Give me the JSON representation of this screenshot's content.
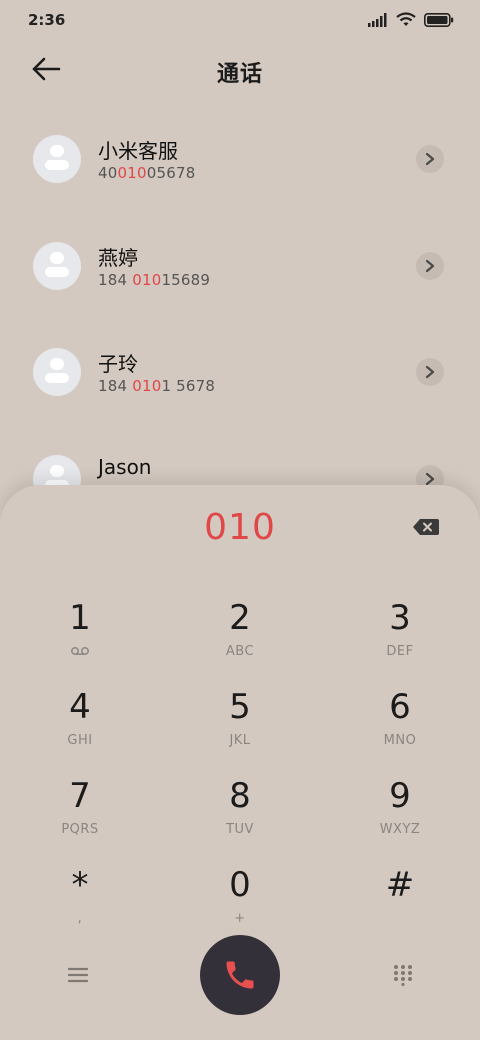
{
  "status_bar": {
    "time": "2:36"
  },
  "header": {
    "title": "通话"
  },
  "contacts": [
    {
      "name": "小米客服",
      "number_parts": [
        "40",
        "010",
        "05678"
      ]
    },
    {
      "name": "燕婷",
      "number_parts": [
        "184 ",
        "010",
        "15689"
      ]
    },
    {
      "name": "子玲",
      "number_parts": [
        "184 ",
        "010",
        "1 5678"
      ]
    },
    {
      "name": "Jason",
      "number_parts": [
        "",
        "",
        ""
      ]
    }
  ],
  "dialer": {
    "typed": "010",
    "keys": [
      {
        "digit": "1",
        "letters": ""
      },
      {
        "digit": "2",
        "letters": "ABC"
      },
      {
        "digit": "3",
        "letters": "DEF"
      },
      {
        "digit": "4",
        "letters": "GHI"
      },
      {
        "digit": "5",
        "letters": "JKL"
      },
      {
        "digit": "6",
        "letters": "MNO"
      },
      {
        "digit": "7",
        "letters": "PQRS"
      },
      {
        "digit": "8",
        "letters": "TUV"
      },
      {
        "digit": "9",
        "letters": "WXYZ"
      },
      {
        "digit": "*",
        "letters": ","
      },
      {
        "digit": "0",
        "letters": "+"
      },
      {
        "digit": "#",
        "letters": ""
      }
    ]
  },
  "icons": {
    "back": "arrow-left-icon",
    "backspace": "backspace-icon",
    "voicemail": "voicemail-icon",
    "menu": "menu-icon",
    "call": "phone-icon",
    "keypad": "dialpad-icon"
  },
  "colors": {
    "background": "#d4c9c1",
    "highlight": "#e04747",
    "call_button": "#34303a"
  }
}
